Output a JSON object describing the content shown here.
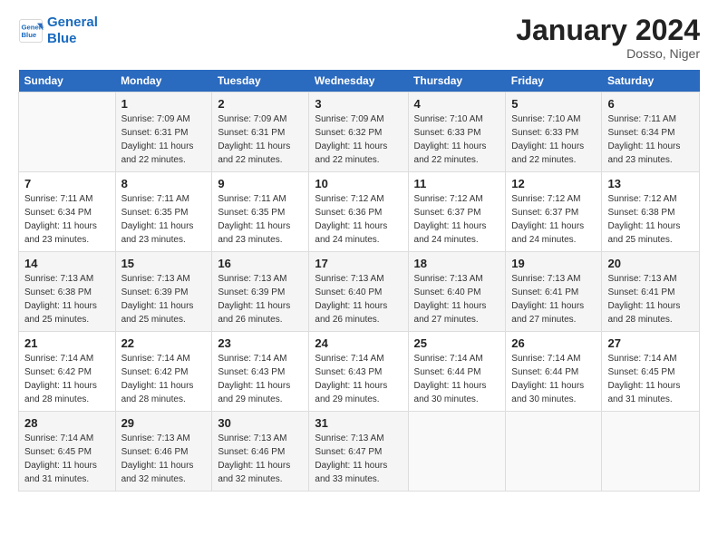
{
  "logo": {
    "line1": "General",
    "line2": "Blue"
  },
  "title": "January 2024",
  "location": "Dosso, Niger",
  "days_header": [
    "Sunday",
    "Monday",
    "Tuesday",
    "Wednesday",
    "Thursday",
    "Friday",
    "Saturday"
  ],
  "weeks": [
    [
      {
        "num": "",
        "info": ""
      },
      {
        "num": "1",
        "info": "Sunrise: 7:09 AM\nSunset: 6:31 PM\nDaylight: 11 hours\nand 22 minutes."
      },
      {
        "num": "2",
        "info": "Sunrise: 7:09 AM\nSunset: 6:31 PM\nDaylight: 11 hours\nand 22 minutes."
      },
      {
        "num": "3",
        "info": "Sunrise: 7:09 AM\nSunset: 6:32 PM\nDaylight: 11 hours\nand 22 minutes."
      },
      {
        "num": "4",
        "info": "Sunrise: 7:10 AM\nSunset: 6:33 PM\nDaylight: 11 hours\nand 22 minutes."
      },
      {
        "num": "5",
        "info": "Sunrise: 7:10 AM\nSunset: 6:33 PM\nDaylight: 11 hours\nand 22 minutes."
      },
      {
        "num": "6",
        "info": "Sunrise: 7:11 AM\nSunset: 6:34 PM\nDaylight: 11 hours\nand 23 minutes."
      }
    ],
    [
      {
        "num": "7",
        "info": "Sunrise: 7:11 AM\nSunset: 6:34 PM\nDaylight: 11 hours\nand 23 minutes."
      },
      {
        "num": "8",
        "info": "Sunrise: 7:11 AM\nSunset: 6:35 PM\nDaylight: 11 hours\nand 23 minutes."
      },
      {
        "num": "9",
        "info": "Sunrise: 7:11 AM\nSunset: 6:35 PM\nDaylight: 11 hours\nand 23 minutes."
      },
      {
        "num": "10",
        "info": "Sunrise: 7:12 AM\nSunset: 6:36 PM\nDaylight: 11 hours\nand 24 minutes."
      },
      {
        "num": "11",
        "info": "Sunrise: 7:12 AM\nSunset: 6:37 PM\nDaylight: 11 hours\nand 24 minutes."
      },
      {
        "num": "12",
        "info": "Sunrise: 7:12 AM\nSunset: 6:37 PM\nDaylight: 11 hours\nand 24 minutes."
      },
      {
        "num": "13",
        "info": "Sunrise: 7:12 AM\nSunset: 6:38 PM\nDaylight: 11 hours\nand 25 minutes."
      }
    ],
    [
      {
        "num": "14",
        "info": "Sunrise: 7:13 AM\nSunset: 6:38 PM\nDaylight: 11 hours\nand 25 minutes."
      },
      {
        "num": "15",
        "info": "Sunrise: 7:13 AM\nSunset: 6:39 PM\nDaylight: 11 hours\nand 25 minutes."
      },
      {
        "num": "16",
        "info": "Sunrise: 7:13 AM\nSunset: 6:39 PM\nDaylight: 11 hours\nand 26 minutes."
      },
      {
        "num": "17",
        "info": "Sunrise: 7:13 AM\nSunset: 6:40 PM\nDaylight: 11 hours\nand 26 minutes."
      },
      {
        "num": "18",
        "info": "Sunrise: 7:13 AM\nSunset: 6:40 PM\nDaylight: 11 hours\nand 27 minutes."
      },
      {
        "num": "19",
        "info": "Sunrise: 7:13 AM\nSunset: 6:41 PM\nDaylight: 11 hours\nand 27 minutes."
      },
      {
        "num": "20",
        "info": "Sunrise: 7:13 AM\nSunset: 6:41 PM\nDaylight: 11 hours\nand 28 minutes."
      }
    ],
    [
      {
        "num": "21",
        "info": "Sunrise: 7:14 AM\nSunset: 6:42 PM\nDaylight: 11 hours\nand 28 minutes."
      },
      {
        "num": "22",
        "info": "Sunrise: 7:14 AM\nSunset: 6:42 PM\nDaylight: 11 hours\nand 28 minutes."
      },
      {
        "num": "23",
        "info": "Sunrise: 7:14 AM\nSunset: 6:43 PM\nDaylight: 11 hours\nand 29 minutes."
      },
      {
        "num": "24",
        "info": "Sunrise: 7:14 AM\nSunset: 6:43 PM\nDaylight: 11 hours\nand 29 minutes."
      },
      {
        "num": "25",
        "info": "Sunrise: 7:14 AM\nSunset: 6:44 PM\nDaylight: 11 hours\nand 30 minutes."
      },
      {
        "num": "26",
        "info": "Sunrise: 7:14 AM\nSunset: 6:44 PM\nDaylight: 11 hours\nand 30 minutes."
      },
      {
        "num": "27",
        "info": "Sunrise: 7:14 AM\nSunset: 6:45 PM\nDaylight: 11 hours\nand 31 minutes."
      }
    ],
    [
      {
        "num": "28",
        "info": "Sunrise: 7:14 AM\nSunset: 6:45 PM\nDaylight: 11 hours\nand 31 minutes."
      },
      {
        "num": "29",
        "info": "Sunrise: 7:13 AM\nSunset: 6:46 PM\nDaylight: 11 hours\nand 32 minutes."
      },
      {
        "num": "30",
        "info": "Sunrise: 7:13 AM\nSunset: 6:46 PM\nDaylight: 11 hours\nand 32 minutes."
      },
      {
        "num": "31",
        "info": "Sunrise: 7:13 AM\nSunset: 6:47 PM\nDaylight: 11 hours\nand 33 minutes."
      },
      {
        "num": "",
        "info": ""
      },
      {
        "num": "",
        "info": ""
      },
      {
        "num": "",
        "info": ""
      }
    ]
  ]
}
